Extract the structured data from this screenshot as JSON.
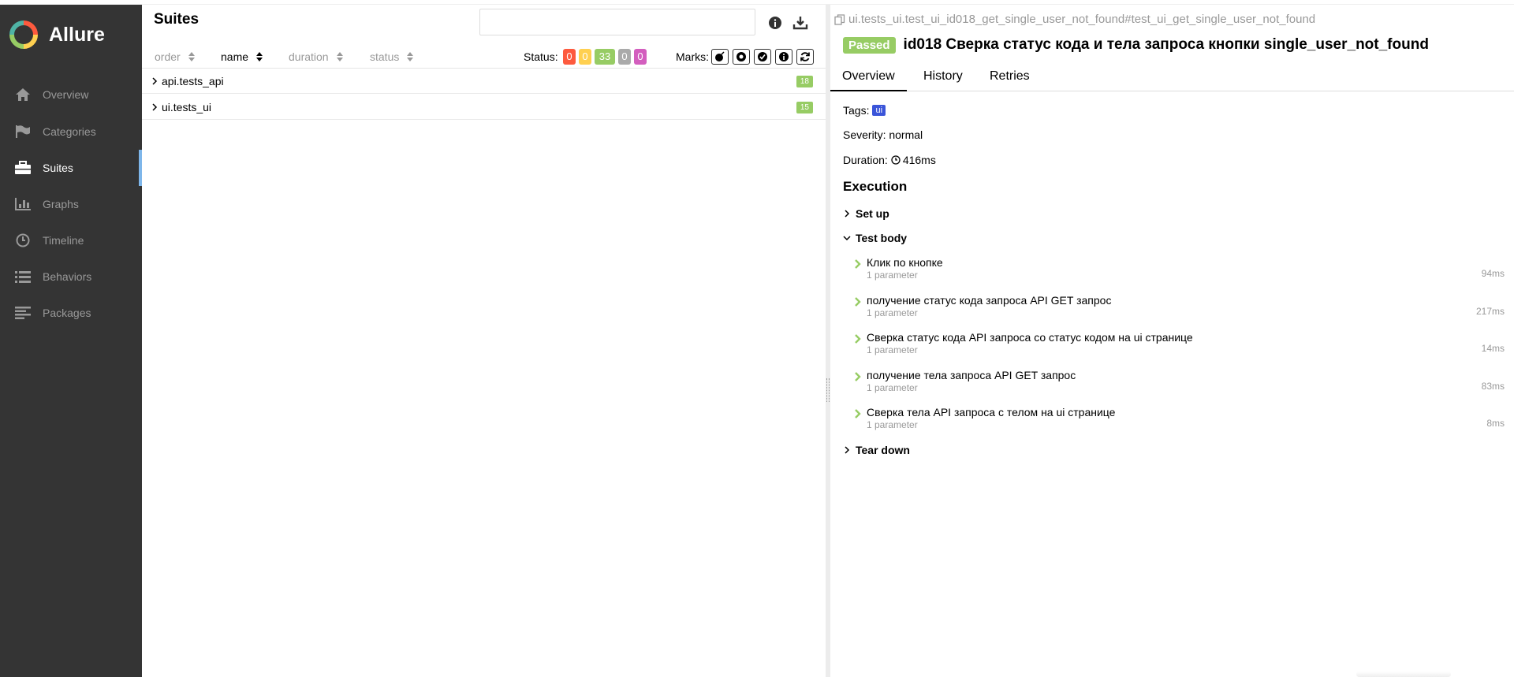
{
  "colors": {
    "sidebar_bg": "#343434",
    "passed": "#97cc64",
    "failed": "#fd5a3e",
    "broken": "#ffd050",
    "skipped": "#aaaaaa",
    "unknown": "#d35ebe",
    "tag": "#3b55d9",
    "active_marker": "#7eb6ea"
  },
  "brand": {
    "name": "Allure"
  },
  "sidebar": {
    "items": [
      {
        "label": "Overview",
        "icon": "home-icon"
      },
      {
        "label": "Categories",
        "icon": "flag-icon"
      },
      {
        "label": "Suites",
        "icon": "briefcase-icon",
        "active": true
      },
      {
        "label": "Graphs",
        "icon": "bar-chart-icon"
      },
      {
        "label": "Timeline",
        "icon": "clock-icon"
      },
      {
        "label": "Behaviors",
        "icon": "list-icon"
      },
      {
        "label": "Packages",
        "icon": "align-left-icon"
      }
    ]
  },
  "suites": {
    "title": "Suites",
    "search": {
      "value": "",
      "placeholder": ""
    },
    "icons": [
      "info-icon",
      "download-icon"
    ],
    "columns": {
      "order": "order",
      "name": "name",
      "duration": "duration",
      "status": "status"
    },
    "status_label": "Status:",
    "status_counts": {
      "failed": "0",
      "broken": "0",
      "passed": "33",
      "skipped": "0",
      "unknown": "0"
    },
    "marks_label": "Marks:",
    "marks": [
      "bomb-icon",
      "bug-icon",
      "check-circle-icon",
      "info-circle-icon",
      "refresh-icon"
    ],
    "rows": [
      {
        "label": "api.tests_api",
        "count": "18"
      },
      {
        "label": "ui.tests_ui",
        "count": "15"
      }
    ]
  },
  "test": {
    "path": "ui.tests_ui.test_ui_id018_get_single_user_not_found#test_ui_get_single_user_not_found",
    "status": "Passed",
    "title": "id018 Сверка статус кода и тела запроса кнопки single_user_not_found",
    "tabs": [
      "Overview",
      "History",
      "Retries"
    ],
    "tags_label": "Tags:",
    "tag": "ui",
    "severity": "Severity: normal",
    "duration_label": "Duration:",
    "duration": "416ms",
    "execution_title": "Execution",
    "setup": "Set up",
    "body": "Test body",
    "teardown": "Tear down",
    "steps": [
      {
        "name": "Клик по кнопке",
        "param": "1 parameter",
        "duration": "94ms"
      },
      {
        "name": "получение статус кода запроса API GET запрос",
        "param": "1 parameter",
        "duration": "217ms"
      },
      {
        "name": "Сверка статус кода API запроса со статус кодом на ui странице",
        "param": "1 parameter",
        "duration": "14ms"
      },
      {
        "name": "получение тела запроса API GET запрос",
        "param": "1 parameter",
        "duration": "83ms"
      },
      {
        "name": "Сверка тела API запроса с телом на ui странице",
        "param": "1 parameter",
        "duration": "8ms"
      }
    ]
  }
}
